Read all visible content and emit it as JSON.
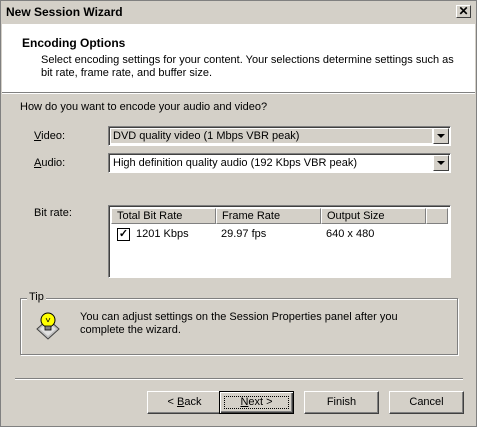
{
  "window": {
    "title": "New Session Wizard",
    "close_glyph": "✕"
  },
  "header": {
    "title": "Encoding Options",
    "description": "Select encoding settings for your content. Your selections determine settings such as bit rate, frame rate, and buffer size."
  },
  "question": "How do you want to encode your audio and video?",
  "video": {
    "label_prefix": "",
    "label_accel": "V",
    "label_rest": "ideo:",
    "value": "DVD quality video (1 Mbps VBR peak)"
  },
  "audio": {
    "label_accel": "A",
    "label_rest": "udio:",
    "value": "High definition quality audio (192 Kbps VBR peak)"
  },
  "bitrate": {
    "label": "Bit rate:",
    "columns": [
      "Total Bit Rate",
      "Frame Rate",
      "Output Size"
    ],
    "rows": [
      {
        "checked": true,
        "total": "1201 Kbps",
        "frame": "29.97 fps",
        "size": "640 x 480"
      }
    ]
  },
  "tip": {
    "legend": "Tip",
    "text": "You can adjust settings on the Session Properties panel after you complete the wizard.",
    "icon": "lightbulb-icon"
  },
  "buttons": {
    "back_prefix": "< ",
    "back_accel": "B",
    "back_rest": "ack",
    "next_accel": "N",
    "next_rest": "ext >",
    "finish": "Finish",
    "cancel": "Cancel"
  }
}
